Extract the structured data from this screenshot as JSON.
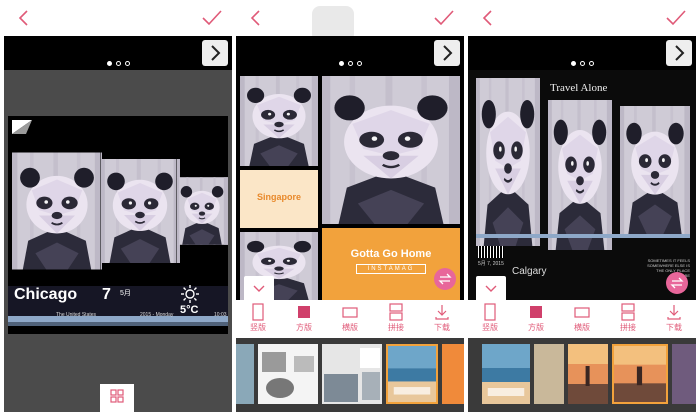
{
  "screen1": {
    "city": "Chicago",
    "day": "7",
    "month": "5月",
    "country": "The United States",
    "date_line": "2015 - Monday",
    "time": "10:03",
    "temperature": "5°C"
  },
  "screen2": {
    "card1_text": "Singapore",
    "card2_title": "Gotta Go Home",
    "card2_sub": "INSTAMAG"
  },
  "screen3": {
    "title": "Travel Alone",
    "date": "5月 7, 2015",
    "city": "Calgary",
    "caption_lines": [
      "SOMETIMES IT FEELS",
      "SOMEWHERE ELSE IS",
      "THE ONLY PLACE",
      "TO BE"
    ]
  },
  "toolbar": {
    "items": [
      {
        "label": "竖版",
        "icon": "portrait-icon"
      },
      {
        "label": "方版",
        "icon": "square-icon"
      },
      {
        "label": "横版",
        "icon": "landscape-icon"
      },
      {
        "label": "拼接",
        "icon": "splice-icon"
      },
      {
        "label": "下载",
        "icon": "download-icon"
      }
    ]
  },
  "colors": {
    "accent": "#e05a78",
    "orange": "#f2a23c",
    "cream": "#fbe6c7",
    "black": "#000000"
  }
}
